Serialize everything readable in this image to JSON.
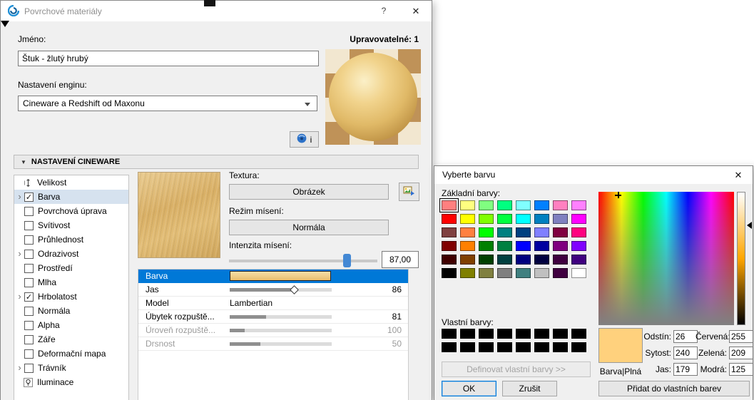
{
  "colors": {
    "accent": "#0078d7",
    "material_tan": "#e8bd72",
    "preview_color": "#ffd17d"
  },
  "main_dialog": {
    "title": "Povrchové materiály",
    "help_label": "?",
    "close_label": "✕",
    "name_label": "Jméno:",
    "editable_label": "Upravovatelné: 1",
    "name_value": "Štuk - žlutý hrubý",
    "engine_label": "Nastavení enginu:",
    "engine_value": "Cineware a Redshift od Maxonu",
    "info_label": "i",
    "section_title": "NASTAVENÍ CINEWARE",
    "tree": [
      {
        "label": "Velikost",
        "icon": "size"
      },
      {
        "label": "Barva",
        "checked": true,
        "expandable": true,
        "selected": true
      },
      {
        "label": "Povrchová úprava",
        "checked": false
      },
      {
        "label": "Svítivost",
        "checked": false
      },
      {
        "label": "Průhlednost",
        "checked": false
      },
      {
        "label": "Odrazivost",
        "checked": false,
        "expandable": true
      },
      {
        "label": "Prostředí",
        "checked": false
      },
      {
        "label": "Mlha",
        "checked": false
      },
      {
        "label": "Hrbolatost",
        "checked": true,
        "expandable": true
      },
      {
        "label": "Normála",
        "checked": false
      },
      {
        "label": "Alpha",
        "checked": false
      },
      {
        "label": "Záře",
        "checked": false
      },
      {
        "label": "Deformační mapa",
        "checked": false
      },
      {
        "label": "Trávník",
        "checked": false,
        "expandable": true
      },
      {
        "label": "Iluminace",
        "icon": "lamp"
      }
    ],
    "panel": {
      "texture_label": "Textura:",
      "texture_button": "Obrázek",
      "blend_label": "Režim mísení:",
      "blend_button": "Normála",
      "intensity_label": "Intenzita mísení:",
      "intensity_value": "87,00",
      "intensity_percent": 80
    },
    "properties": [
      {
        "name": "Barva",
        "type": "swatch",
        "selected": true
      },
      {
        "name": "Jas",
        "type": "slider",
        "value": "86",
        "percent": 62,
        "diamond": true
      },
      {
        "name": "Model",
        "type": "text",
        "value": "Lambertian"
      },
      {
        "name": "Úbytek rozpuště...",
        "type": "slider",
        "value": "81",
        "percent": 36
      },
      {
        "name": "Úroveň rozpuště...",
        "type": "slider",
        "value": "100",
        "percent": 15,
        "disabled": true
      },
      {
        "name": "Drsnost",
        "type": "slider",
        "value": "50",
        "percent": 30,
        "disabled": true
      }
    ]
  },
  "color_dialog": {
    "title": "Vyberte barvu",
    "close_label": "✕",
    "basic_label": "Základní barvy:",
    "selected_basic_index": 0,
    "basic_colors": [
      "#ff8080",
      "#ffff80",
      "#80ff80",
      "#00ff80",
      "#80ffff",
      "#0080ff",
      "#ff80c0",
      "#ff80ff",
      "#ff0000",
      "#ffff00",
      "#80ff00",
      "#00ff40",
      "#00ffff",
      "#0080c0",
      "#8080c0",
      "#ff00ff",
      "#804040",
      "#ff8040",
      "#00ff00",
      "#008080",
      "#004080",
      "#8080ff",
      "#800040",
      "#ff0080",
      "#800000",
      "#ff8000",
      "#008000",
      "#008040",
      "#0000ff",
      "#0000a0",
      "#800080",
      "#8000ff",
      "#400000",
      "#804000",
      "#004000",
      "#004040",
      "#000080",
      "#000040",
      "#400040",
      "#400080",
      "#000000",
      "#808000",
      "#808040",
      "#808080",
      "#408080",
      "#c0c0c0",
      "#400040",
      "#ffffff"
    ],
    "custom_label": "Vlastní barvy:",
    "custom_colors": [
      "#000000",
      "#000000",
      "#000000",
      "#000000",
      "#000000",
      "#000000",
      "#000000",
      "#000000",
      "#000000",
      "#000000",
      "#000000",
      "#000000",
      "#000000",
      "#000000",
      "#000000",
      "#000000"
    ],
    "define_button": "Definovat vlastní barvy >>",
    "ok_button": "OK",
    "cancel_button": "Zrušit",
    "add_button": "Přidat do vlastních barev",
    "preview_label": "Barva|Plná",
    "preview_color": "#ffd17d",
    "hsl_fields": [
      {
        "label": "Odstín:",
        "value": "26"
      },
      {
        "label": "Sytost:",
        "value": "240"
      },
      {
        "label": "Jas:",
        "value": "179"
      }
    ],
    "rgb_fields": [
      {
        "label": "Červená:",
        "value": "255"
      },
      {
        "label": "Zelená:",
        "value": "209"
      },
      {
        "label": "Modrá:",
        "value": "125"
      }
    ],
    "luminance_arrow_percent": 25.4,
    "hue_marker_percent_x": 14
  }
}
